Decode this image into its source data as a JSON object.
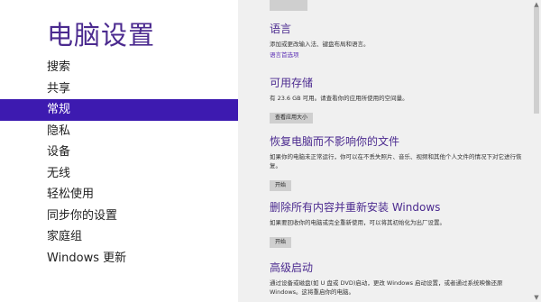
{
  "left": {
    "title": "电脑设置",
    "nav": [
      {
        "label": "搜索"
      },
      {
        "label": "共享"
      },
      {
        "label": "常规",
        "active": true
      },
      {
        "label": "隐私"
      },
      {
        "label": "设备"
      },
      {
        "label": "无线"
      },
      {
        "label": "轻松使用"
      },
      {
        "label": "同步你的设置"
      },
      {
        "label": "家庭组"
      },
      {
        "label": "Windows 更新"
      }
    ]
  },
  "right": {
    "sections": [
      {
        "title": "语言",
        "desc": "添加或更改输入法、键盘布局和语言。",
        "link": "语言首选项"
      },
      {
        "title": "可用存储",
        "desc": "有 23.6 GB 可用。请查看你的应用所使用的空间量。",
        "button": "查看应用大小"
      },
      {
        "title": "恢复电脑而不影响你的文件",
        "desc": "如果你的电脑未正常运行，你可以在不丢失照片、音乐、视频和其他个人文件的情况下对它进行恢复。",
        "button": "开始"
      },
      {
        "title": "删除所有内容并重新安装 Windows",
        "desc": "如果要回收你的电脑或完全重新使用，可以将其初始化为出厂设置。",
        "button": "开始"
      },
      {
        "title": "高级启动",
        "desc": "通过设备或磁盘(如 U 盘或 DVD)启动，更改 Windows 启动设置，或者通过系统映像还原 Windows。这将重启你的电脑。"
      }
    ]
  },
  "icons": {
    "scroll_up": "scroll-up-arrow-icon",
    "scroll_down": "scroll-down-arrow-icon"
  },
  "colors": {
    "accent": "#3d1ab0",
    "title": "#4b2a8f",
    "panel": "#f0f0f0"
  }
}
